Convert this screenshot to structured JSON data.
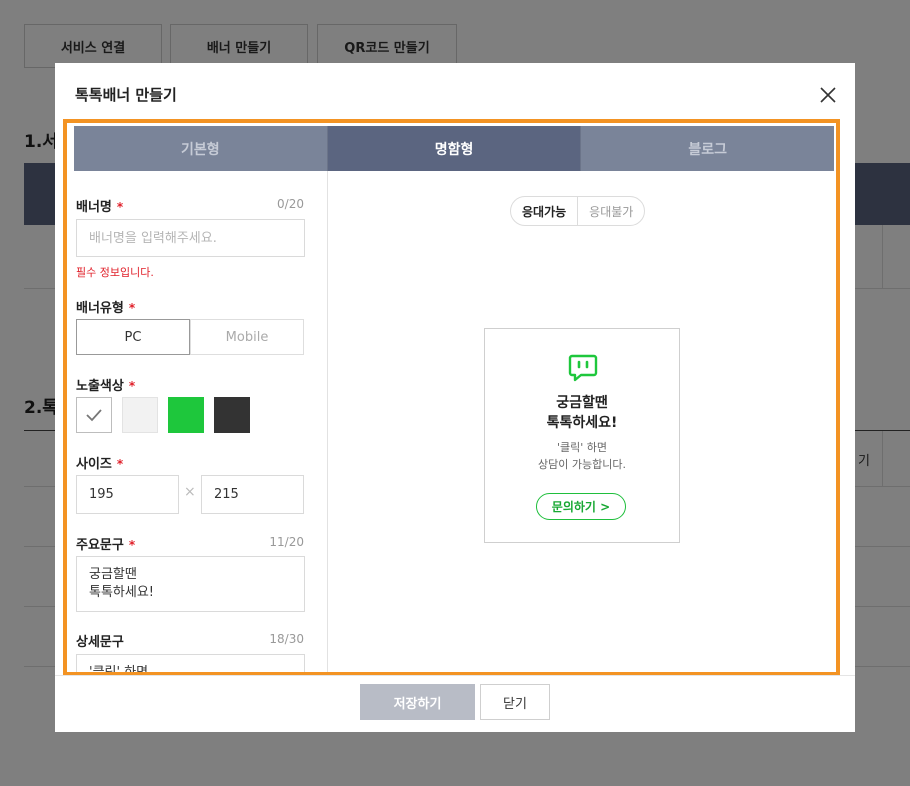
{
  "background": {
    "tabs": [
      "서비스 연결",
      "배너 만들기",
      "QR코드 만들기"
    ],
    "section1_heading": "1.서",
    "section2_heading": "2.톡",
    "table_fragment": "기"
  },
  "modal": {
    "title": "톡톡배너 만들기",
    "tabs": [
      {
        "label": "기본형"
      },
      {
        "label": "명함형"
      },
      {
        "label": "블로그"
      }
    ],
    "form": {
      "banner_name": {
        "label": "배너명",
        "required_mark": "*",
        "counter": "0/20",
        "placeholder": "배너명을 입력해주세요.",
        "value": "",
        "error": "필수 정보입니다."
      },
      "banner_type": {
        "label": "배너유형",
        "required_mark": "*",
        "options": [
          "PC",
          "Mobile"
        ],
        "selected": "PC"
      },
      "color": {
        "label": "노출색상",
        "required_mark": "*",
        "swatches": [
          "#ffffff",
          "#f2f2f2",
          "#1ec73c",
          "#333333"
        ],
        "selected_index": 0
      },
      "size": {
        "label": "사이즈",
        "required_mark": "*",
        "width": "195",
        "height": "215",
        "separator": "×"
      },
      "main_text": {
        "label": "주요문구",
        "required_mark": "*",
        "counter": "11/20",
        "value": "궁금할땐\n톡톡하세요!"
      },
      "detail_text": {
        "label": "상세문구",
        "counter": "18/30",
        "value": "'클릭' 하면"
      }
    },
    "preview": {
      "status_options": [
        "응대가능",
        "응대불가"
      ],
      "status_selected": "응대가능",
      "card": {
        "icon": "talktalk-chat-icon",
        "main_line1": "궁금할땐",
        "main_line2": "톡톡하세요!",
        "sub_line1": "'클릭' 하면",
        "sub_line2": "상담이 가능합니다.",
        "button_label": "문의하기 >"
      }
    },
    "footer": {
      "save_label": "저장하기",
      "close_label": "닫기"
    },
    "colors": {
      "highlight_border": "#f39323",
      "tab_active": "#5b6580",
      "tab_inactive": "#7a8499",
      "brand_green": "#1ec73c",
      "required_red": "#e0202a"
    }
  }
}
